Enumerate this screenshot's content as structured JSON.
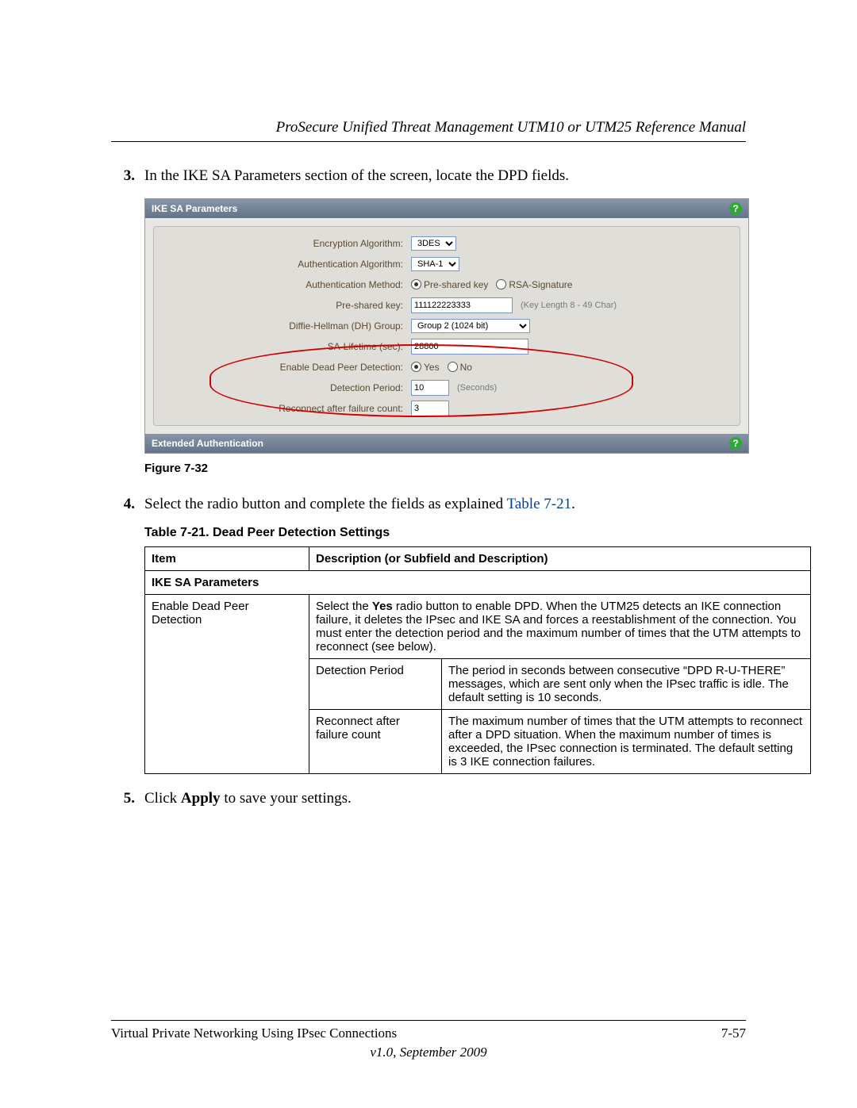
{
  "header": {
    "title": "ProSecure Unified Threat Management UTM10 or UTM25 Reference Manual"
  },
  "steps": {
    "s3_num": "3.",
    "s3_text": "In the IKE SA Parameters section of the screen, locate the DPD fields.",
    "s4_num": "4.",
    "s4_pre": "Select the radio button and complete the fields as explained ",
    "s4_link": "Table 7-21",
    "s4_post": ".",
    "s5_num": "5.",
    "s5_pre": "Click ",
    "s5_bold": "Apply",
    "s5_post": " to save your settings."
  },
  "figure": {
    "caption": "Figure 7-32",
    "panel_title": "IKE SA Parameters",
    "ext_title": "Extended Authentication",
    "labels": {
      "enc": "Encryption Algorithm:",
      "auth_algo": "Authentication Algorithm:",
      "auth_method": "Authentication Method:",
      "psk": "Pre-shared key:",
      "dh": "Diffie-Hellman (DH) Group:",
      "sa_life": "SA-Lifetime (sec):",
      "dpd_enable": "Enable Dead Peer Detection:",
      "dpd_period": "Detection Period:",
      "dpd_reconnect": "Reconnect after failure count:"
    },
    "values": {
      "enc": "3DES",
      "auth_algo": "SHA-1",
      "psk": "111122223333",
      "dh": "Group 2 (1024 bit)",
      "sa_life": "28800",
      "dpd_period": "10",
      "dpd_reconnect": "3"
    },
    "radios": {
      "psk_label": "Pre-shared key",
      "rsa_label": "RSA-Signature",
      "yes": "Yes",
      "no": "No"
    },
    "hints": {
      "key_len": "(Key Length 8 - 49 Char)",
      "seconds": "(Seconds)"
    }
  },
  "table": {
    "caption": "Table 7-21. Dead Peer Detection Settings",
    "head_item": "Item",
    "head_desc": "Description (or Subfield and Description)",
    "section": "IKE SA Parameters",
    "row1_item": "Enable Dead Peer Detection",
    "row1_desc_pre": "Select the ",
    "row1_desc_bold": "Yes",
    "row1_desc_post": " radio button to enable DPD. When the UTM25 detects an IKE connection failure, it deletes the IPsec and IKE SA and forces a reestablishment of the connection. You must enter the detection period and the maximum number of times that the UTM attempts to reconnect (see below).",
    "row2_sub": "Detection Period",
    "row2_desc": "The period in seconds between consecutive “DPD R-U-THERE” messages, which are sent only when the IPsec traffic is idle. The default setting is 10 seconds.",
    "row3_sub": "Reconnect after failure count",
    "row3_desc": "The maximum number of times that the UTM attempts to reconnect after a DPD situation. When the maximum number of times is exceeded, the IPsec connection is terminated. The default setting is 3 IKE connection failures."
  },
  "footer": {
    "chapter": "Virtual Private Networking Using IPsec Connections",
    "page": "7-57",
    "version": "v1.0, September 2009"
  }
}
